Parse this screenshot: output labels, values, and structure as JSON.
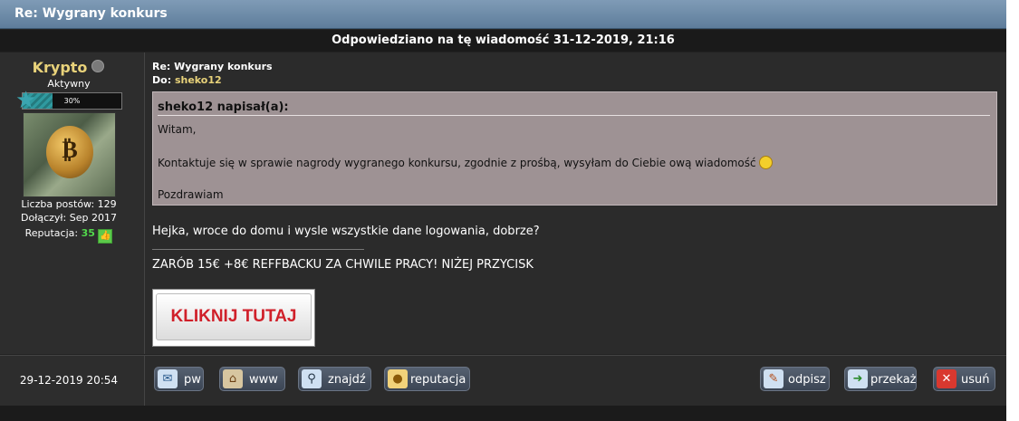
{
  "window": {
    "title": "Re: Wygrany konkurs"
  },
  "reply_info": "Odpowiedziano na tę wiadomość 31-12-2019, 21:16",
  "author": {
    "name": "Krypto",
    "rank": "Aktywny",
    "progress_label": "30%",
    "progress": 0.3,
    "posts_text": "Liczba postów: 129",
    "joined_text": "Dołączył: Sep 2017",
    "reputation_label": "Reputacja:",
    "reputation_value": "35"
  },
  "message": {
    "title": "Re: Wygrany konkurs",
    "to_label": "Do:",
    "to_name": "sheko12",
    "quote": {
      "header": "sheko12 napisał(a):",
      "lines": [
        "Witam,",
        "Kontaktuje się w sprawie nagrody wygranego konkursu, zgodnie z prośbą, wysyłam do Ciebie ową wiadomość",
        "Pozdrawiam"
      ]
    },
    "reply_text": "Hejka, wroce do domu i wysle wszystkie dane logowania, dobrze?",
    "signature_text": "ZARÓB 15€ +8€ REFFBACKU ZA CHWILE PRACY! NIŻEJ PRZYCISK",
    "cta_label": "KLIKNIJ TUTAJ"
  },
  "post_date": "29-12-2019 20:54",
  "buttons": {
    "pw": "pw",
    "www": "www",
    "find": "znajdź",
    "reputation": "reputacja",
    "reply": "odpisz",
    "forward": "przekaż",
    "delete": "usuń"
  },
  "icons": {
    "pw": "envelope-icon",
    "www": "house-icon",
    "find": "magnifier-icon",
    "reputation": "medal-icon",
    "reply": "envelope-pen-icon",
    "forward": "envelope-arrow-icon",
    "delete": "red-x-icon"
  },
  "colors": {
    "title_bar": "#6f8ca8",
    "username": "#e8d27a",
    "reputation_value": "#52d84b",
    "quote_bg": "#9e9294",
    "cta_text": "#d0202a"
  }
}
